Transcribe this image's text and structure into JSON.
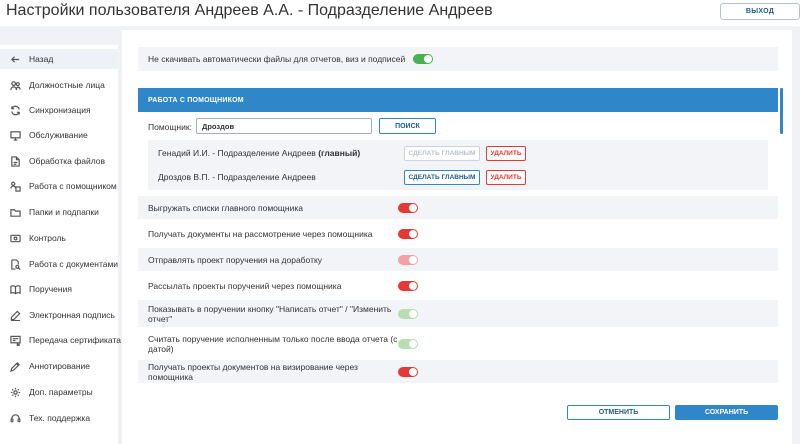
{
  "header": {
    "title": "Настройки пользователя Андреев А.А. - Подразделение Андреев",
    "logout_label": "ВЫХОД"
  },
  "sidebar": {
    "back_label": "Назад",
    "items": [
      {
        "label": "Должностные лица",
        "icon": "users-icon"
      },
      {
        "label": "Синхронизация",
        "icon": "sync-icon"
      },
      {
        "label": "Обслуживание",
        "icon": "monitor-icon"
      },
      {
        "label": "Обработка файлов",
        "icon": "file-process-icon"
      },
      {
        "label": "Работа с помощником",
        "icon": "assistant-icon"
      },
      {
        "label": "Папки и подпапки",
        "icon": "folder-icon"
      },
      {
        "label": "Контроль",
        "icon": "eye-icon"
      },
      {
        "label": "Работа с документами",
        "icon": "document-search-icon"
      },
      {
        "label": "Поручения",
        "icon": "book-icon"
      },
      {
        "label": "Электронная подпись",
        "icon": "pen-icon"
      },
      {
        "label": "Передача сертификата",
        "icon": "certificate-icon"
      },
      {
        "label": "Аннотирование",
        "icon": "annotation-icon"
      },
      {
        "label": "Доп. параметры",
        "icon": "gear-icon"
      },
      {
        "label": "Тех. поддержка",
        "icon": "support-icon"
      }
    ]
  },
  "main": {
    "top_setting": {
      "label": "Не скачивать автоматически файлы для отчетов, виз и подписей",
      "state": "on"
    },
    "section_title": "РАБОТА С ПОМОЩНИКОМ",
    "assistant_label": "Помощник:",
    "assistant_value": "Дроздов",
    "search_label": "ПОИСК",
    "assistants": [
      {
        "name": "Генадий И.И. - Подразделение Андреев",
        "tag": "(главный)",
        "make_main_label": "СДЕЛАТЬ ГЛАВНЫМ",
        "make_main_enabled": false,
        "delete_label": "УДАЛИТЬ"
      },
      {
        "name": "Дроздов В.П. - Подразделение Андреев",
        "tag": "",
        "make_main_label": "СДЕЛАТЬ ГЛАВНЫМ",
        "make_main_enabled": true,
        "delete_label": "УДАЛИТЬ"
      }
    ],
    "settings": [
      {
        "label": "Выгружать списки главного помощника",
        "state": "on",
        "color": "#e53935"
      },
      {
        "label": "Получать документы на рассмотрение через помощника",
        "state": "on",
        "color": "#e53935"
      },
      {
        "label": "Отправлять проект поручения на доработку",
        "state": "on",
        "color": "#f3a0a6"
      },
      {
        "label": "Рассылать проекты поручений через помощника",
        "state": "on",
        "color": "#e53935"
      },
      {
        "label": "Показывать в поручении кнопку \"Написать отчет\" / \"Изменить отчет\"",
        "state": "on",
        "color": "#b9dcb3"
      },
      {
        "label": "Считать поручение исполненным только после ввода отчета (с датой)",
        "state": "on",
        "color": "#b9dcb3"
      },
      {
        "label": "Получать проекты документов на визирование через помощника",
        "state": "on",
        "color": "#e53935"
      }
    ],
    "cancel_label": "ОТМЕНИТЬ",
    "save_label": "СОХРАНИТЬ"
  },
  "colors": {
    "accent": "#2f86c8",
    "toggle_on": "#4caf50",
    "toggle_red": "#e53935"
  }
}
